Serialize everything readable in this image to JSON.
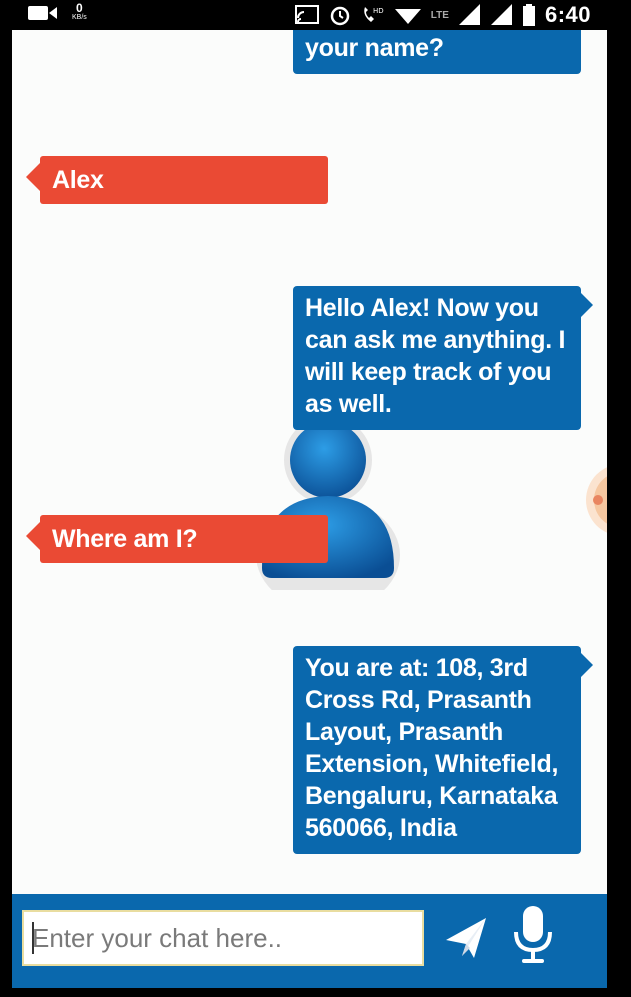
{
  "status_bar": {
    "data_rate_value": "0",
    "data_rate_unit": "KB/s",
    "network_label": "LTE",
    "time": "6:40"
  },
  "chat": {
    "messages": [
      {
        "from": "bot",
        "text": "your name?"
      },
      {
        "from": "user",
        "text": "Alex"
      },
      {
        "from": "bot",
        "text": "Hello Alex! Now you can ask me anything. I will keep track of you as well."
      },
      {
        "from": "user",
        "text": "Where am I?"
      },
      {
        "from": "bot",
        "text": "You are at: 108, 3rd Cross Rd, Prasanth Layout, Prasanth Extension, Whitefield, Bengaluru, Karnataka 560066, India"
      }
    ]
  },
  "input_bar": {
    "placeholder": "Enter your chat here..",
    "value": "",
    "send_icon": "send-icon",
    "mic_icon": "microphone-icon"
  },
  "colors": {
    "bot_bubble": "#0a68ad",
    "user_bubble": "#ea4a34",
    "chat_background": "#fbfcfb",
    "input_bar": "#0a68ad"
  }
}
